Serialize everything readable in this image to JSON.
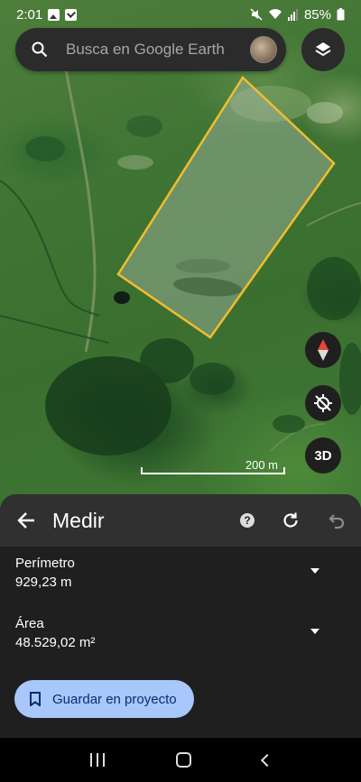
{
  "status_bar": {
    "time": "2:01",
    "battery": "85%"
  },
  "search": {
    "placeholder": "Busca en Google Earth"
  },
  "map": {
    "scale_label": "200 m",
    "button_3d": "3D",
    "polygon_color": "#f2bd2b"
  },
  "sheet": {
    "title": "Medir",
    "perimeter": {
      "label": "Perímetro",
      "value": "929,23 m"
    },
    "area": {
      "label": "Área",
      "value": "48.529,02 m²"
    },
    "save_label": "Guardar en proyecto"
  },
  "colors": {
    "accent": "#a8c7fa",
    "sheet_bg": "#1f1f1f",
    "header_bg": "#303030"
  },
  "icons": [
    "image-icon",
    "check-icon",
    "mute-icon",
    "wifi-icon",
    "signal-icon",
    "battery-icon",
    "search-icon",
    "layers-icon",
    "compass-icon",
    "location-off-icon",
    "back-arrow-icon",
    "help-icon",
    "refresh-icon",
    "undo-icon",
    "chevron-down-icon",
    "bookmark-icon"
  ]
}
